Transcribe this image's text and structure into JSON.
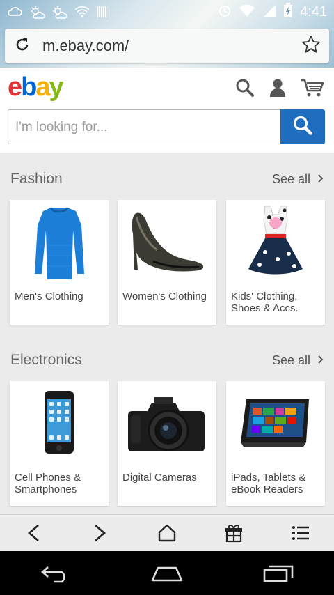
{
  "status_bar": {
    "time": "4:41",
    "notification_icons": [
      "cloud-icon",
      "sun-cloud-icon",
      "sun-cloud-icon",
      "wifi-alert-icon",
      "barcode-icon"
    ],
    "system_icons": [
      "alarm-icon",
      "wifi-icon",
      "signal-icon",
      "battery-charging-icon"
    ]
  },
  "browser": {
    "url": "m.ebay.com/",
    "toolbar_icons": [
      "back-arrow-icon",
      "forward-arrow-icon",
      "home-icon",
      "gift-icon",
      "menu-list-icon"
    ]
  },
  "header": {
    "logo": {
      "e": "e",
      "b": "b",
      "a": "a",
      "y": "y"
    },
    "search_placeholder": "I'm looking for..."
  },
  "sections": [
    {
      "title": "Fashion",
      "see_all": "See all",
      "items": [
        {
          "label": "Men's Clothing",
          "image": "blue-sweater-image"
        },
        {
          "label": "Women's Clothing",
          "image": "high-heel-shoe-image"
        },
        {
          "label": "Kids' Clothing, Shoes & Accs.",
          "image": "kids-dress-image"
        }
      ]
    },
    {
      "title": "Electronics",
      "see_all": "See all",
      "items": [
        {
          "label": "Cell Phones & Smartphones",
          "image": "smartphone-image"
        },
        {
          "label": "Digital Cameras",
          "image": "dslr-camera-image"
        },
        {
          "label": "iPads, Tablets & eBook Readers",
          "image": "tablet-image"
        }
      ]
    }
  ],
  "colors": {
    "ebay_red": "#e53238",
    "ebay_blue": "#0064d2",
    "ebay_yellow": "#f5af02",
    "ebay_green": "#86b817",
    "search_button": "#1f6dbe"
  }
}
